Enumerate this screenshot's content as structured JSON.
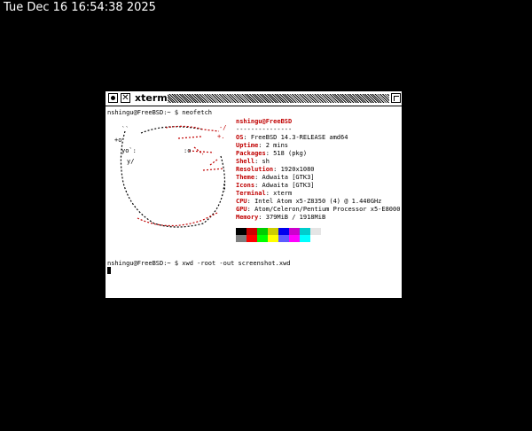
{
  "desktop": {
    "clock": "Tue Dec 16 16:54:38 2025"
  },
  "window": {
    "title": "xterm"
  },
  "terminal": {
    "prompt1": "nshingu@FreeBSD:~ $ neofetch",
    "prompt2": "nshingu@FreeBSD:~ $ xwd -root -out screenshot.xwd",
    "user_host": "nshingu@FreeBSD",
    "separator": "---------------",
    "info": [
      {
        "key": "OS",
        "value": ": FreeBSD 14.3-RELEASE amd64"
      },
      {
        "key": "Uptime",
        "value": ": 2 mins"
      },
      {
        "key": "Packages",
        "value": ": 518 (pkg)"
      },
      {
        "key": "Shell",
        "value": ": sh"
      },
      {
        "key": "Resolution",
        "value": ": 1920x1080"
      },
      {
        "key": "Theme",
        "value": ": Adwaita [GTK3]"
      },
      {
        "key": "Icons",
        "value": ": Adwaita [GTK3]"
      },
      {
        "key": "Terminal",
        "value": ": xterm"
      },
      {
        "key": "CPU",
        "value": ": Intel Atom x5-Z8350 (4) @ 1.440GHz"
      },
      {
        "key": "GPU",
        "value": ": Atom/Celeron/Pentium Processor x5-E8000"
      },
      {
        "key": "Memory",
        "value": ": 379MiB / 1918MiB"
      }
    ],
    "palette_row1": [
      "#000000",
      "#cd0000",
      "#00cd00",
      "#cdcd00",
      "#0000ee",
      "#cd00cd",
      "#00cdcd",
      "#e5e5e5"
    ],
    "palette_row2": [
      "#7f7f7f",
      "#ff0000",
      "#00ff00",
      "#ffff00",
      "#5c5cff",
      "#ff00ff",
      "#00ffff",
      "#ffffff"
    ]
  }
}
